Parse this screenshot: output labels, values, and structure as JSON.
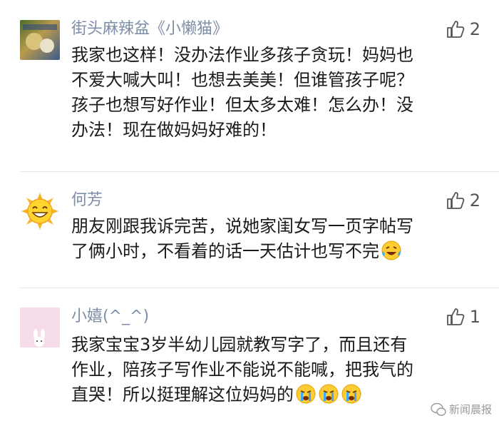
{
  "comments": [
    {
      "name": "街头麻辣盆《小懒猫》",
      "likes": "2",
      "lines": [
        "我家也这样！没办法作业多孩子贪玩！妈妈也",
        "不爱大喊大叫！也想去美美！但谁管孩子呢？",
        "孩子也想写好作业！但太多太难！怎么办！没",
        "办法！现在做妈妈好难的！"
      ]
    },
    {
      "name": "何芳",
      "likes": "2",
      "lines": [
        "朋友刚跟我诉完苦，说她家闺女写一页字帖写",
        "了俩小时，不看着的话一天估计也写不完"
      ],
      "trailing_emoji": "laughing-tears-emoji"
    },
    {
      "name": "小嬉(^_^)",
      "likes": "1",
      "lines": [
        "我家宝宝3岁半幼儿园就教写字了，而且还有",
        "作业，陪孩子写作业不能说不能喊，把我气的",
        "直哭！所以挺理解这位妈妈的"
      ],
      "trailing_emoji": "crying-emoji x3"
    }
  ],
  "watermark": "新闻晨报",
  "colors": {
    "name": "#7e8ea6",
    "text": "#1a1a1a",
    "divider": "#e6e6e6"
  }
}
